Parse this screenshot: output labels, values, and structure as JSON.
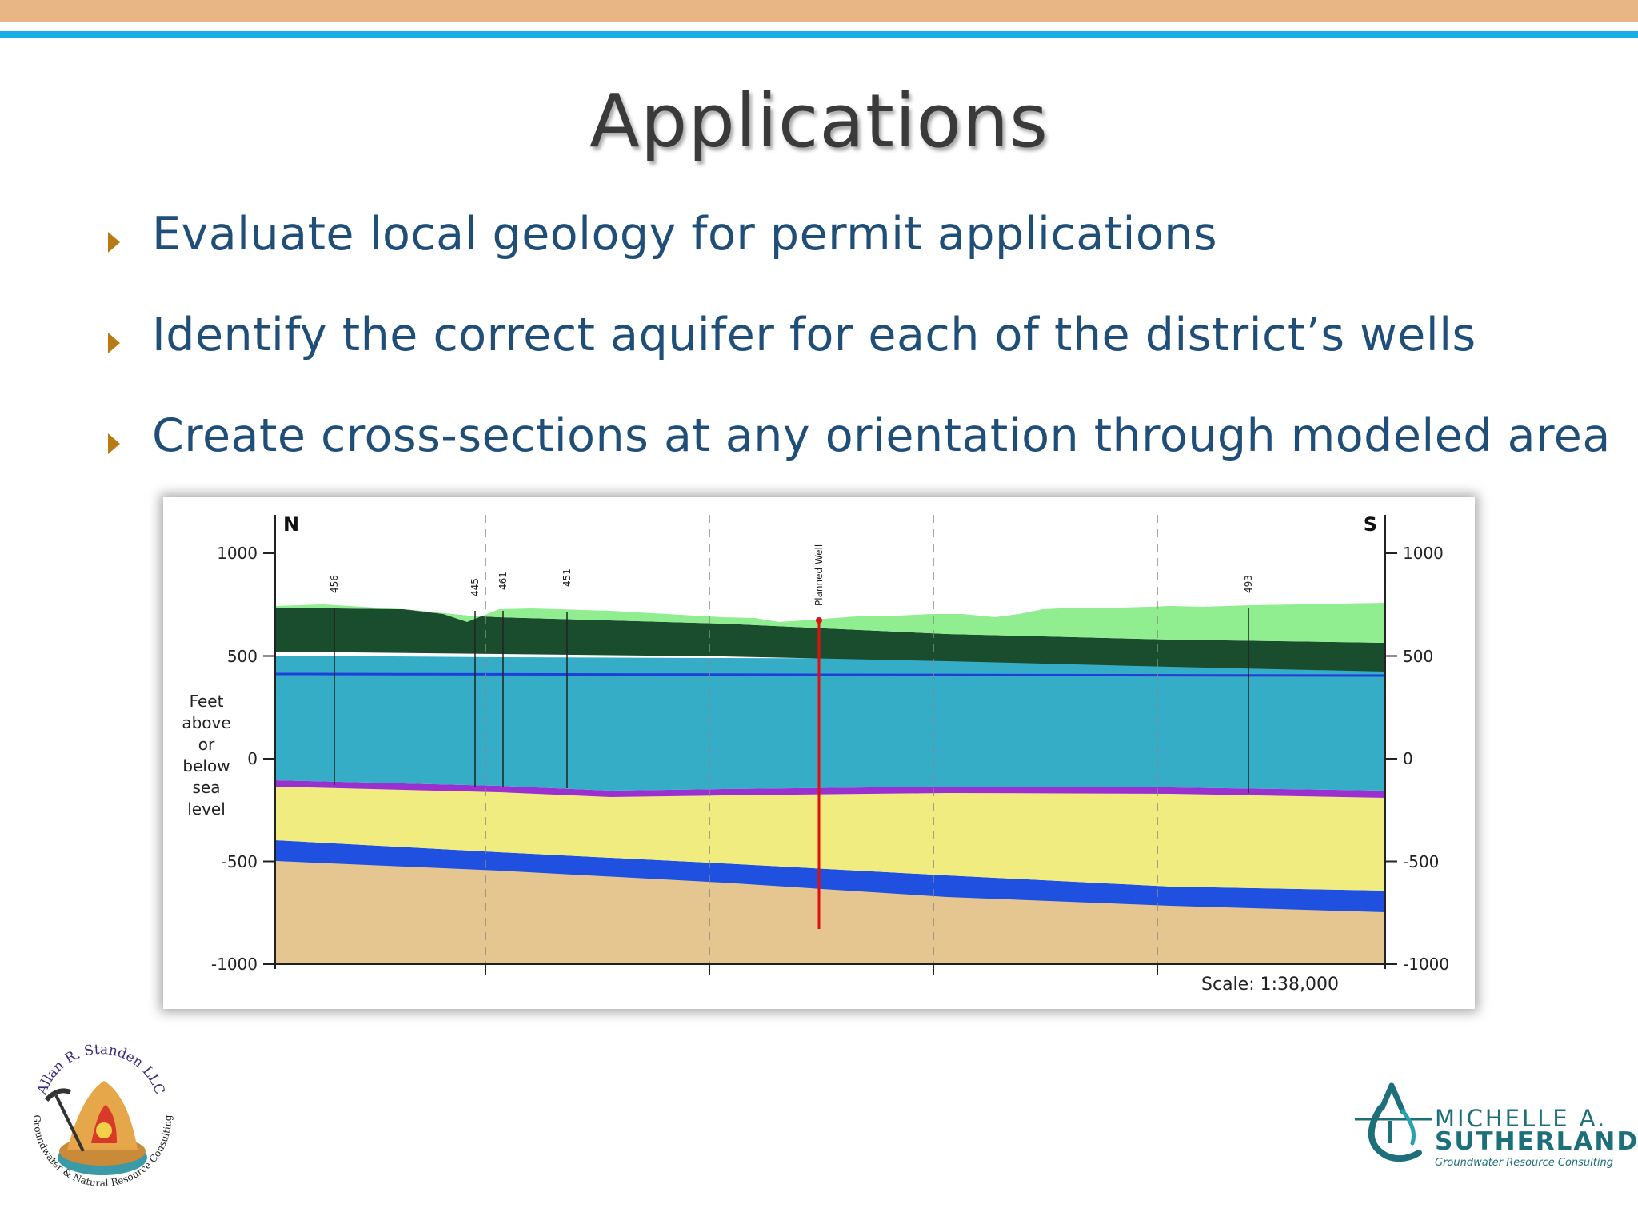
{
  "slide": {
    "title": "Applications",
    "bullets": [
      "Evaluate local geology for permit applications",
      "Identify the correct aquifer for each of the district’s wells",
      "Create cross-sections at any orientation through modeled area"
    ]
  },
  "figure": {
    "direction_left": "N",
    "direction_right": "S",
    "y_axis_label_lines": [
      "Feet",
      "above",
      "or",
      "below",
      "sea",
      "level"
    ],
    "y_ticks": [
      "1000",
      "500",
      "0",
      "-500",
      "-1000"
    ],
    "well_labels": [
      "456",
      "445",
      "461",
      "451",
      "Planned Well",
      "493"
    ],
    "scale_text": "Scale: 1:38,000",
    "colors": {
      "surface_green": "#90ee90",
      "dark_green": "#1a4d2e",
      "aquifer_blue": "#35adc7",
      "purple": "#9b30d0",
      "yellow": "#f0ec80",
      "deep_blue": "#2050e0",
      "tan": "#e5c690",
      "planned_well_red": "#e01010"
    }
  },
  "logos": {
    "left_arc_top": "Allan R. Standen LLC",
    "left_arc_bottom": "Groundwater & Natural Resource Consulting",
    "right_name_line1": "MICHELLE A.",
    "right_name_line2": "SUTHERLAND",
    "right_tagline": "Groundwater Resource Consulting"
  }
}
